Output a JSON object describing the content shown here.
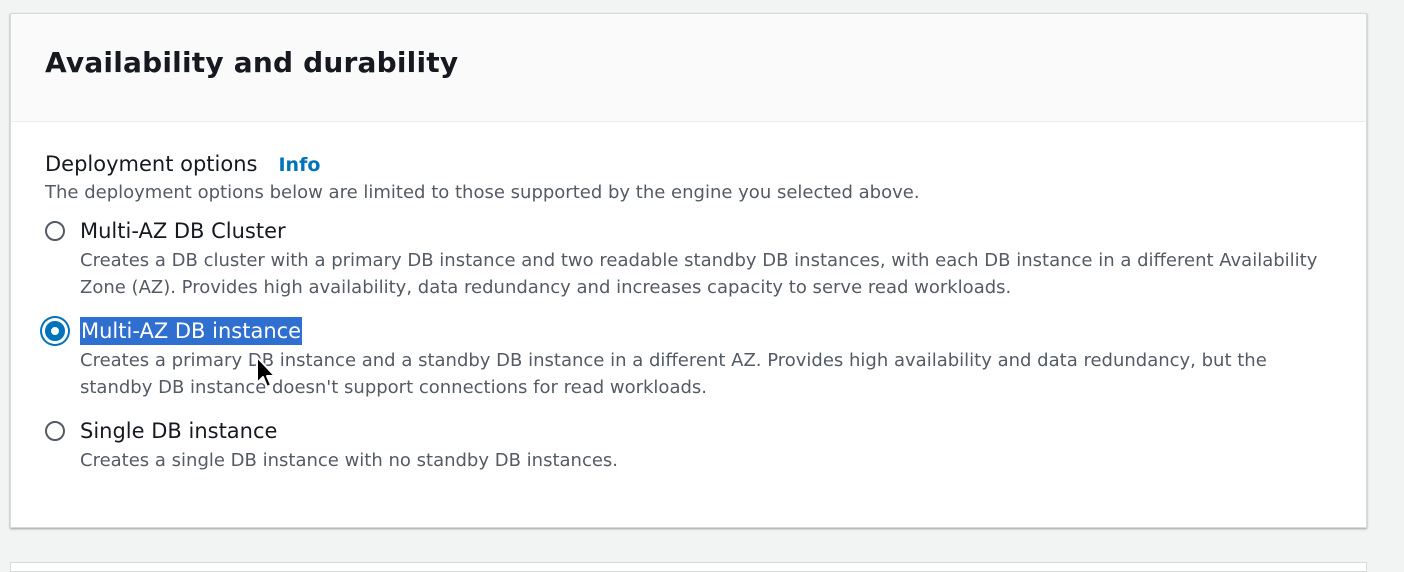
{
  "panel": {
    "title": "Availability and durability"
  },
  "deployment": {
    "label": "Deployment options",
    "info_link": "Info",
    "description": "The deployment options below are limited to those supported by the engine you selected above.",
    "options": [
      {
        "label": "Multi-AZ DB Cluster",
        "description": "Creates a DB cluster with a primary DB instance and two readable standby DB instances, with each DB instance in a different Availability Zone (AZ). Provides high availability, data redundancy and increases capacity to serve read workloads.",
        "selected": false
      },
      {
        "label": "Multi-AZ DB instance",
        "description": "Creates a primary DB instance and a standby DB instance in a different AZ. Provides high availability and data redundancy, but the standby DB instance doesn't support connections for read workloads.",
        "selected": true
      },
      {
        "label": "Single DB instance",
        "description": "Creates a single DB instance with no standby DB instances.",
        "selected": false
      }
    ]
  },
  "colors": {
    "accent": "#0073bb",
    "text_selection": "#2f6fcf"
  }
}
